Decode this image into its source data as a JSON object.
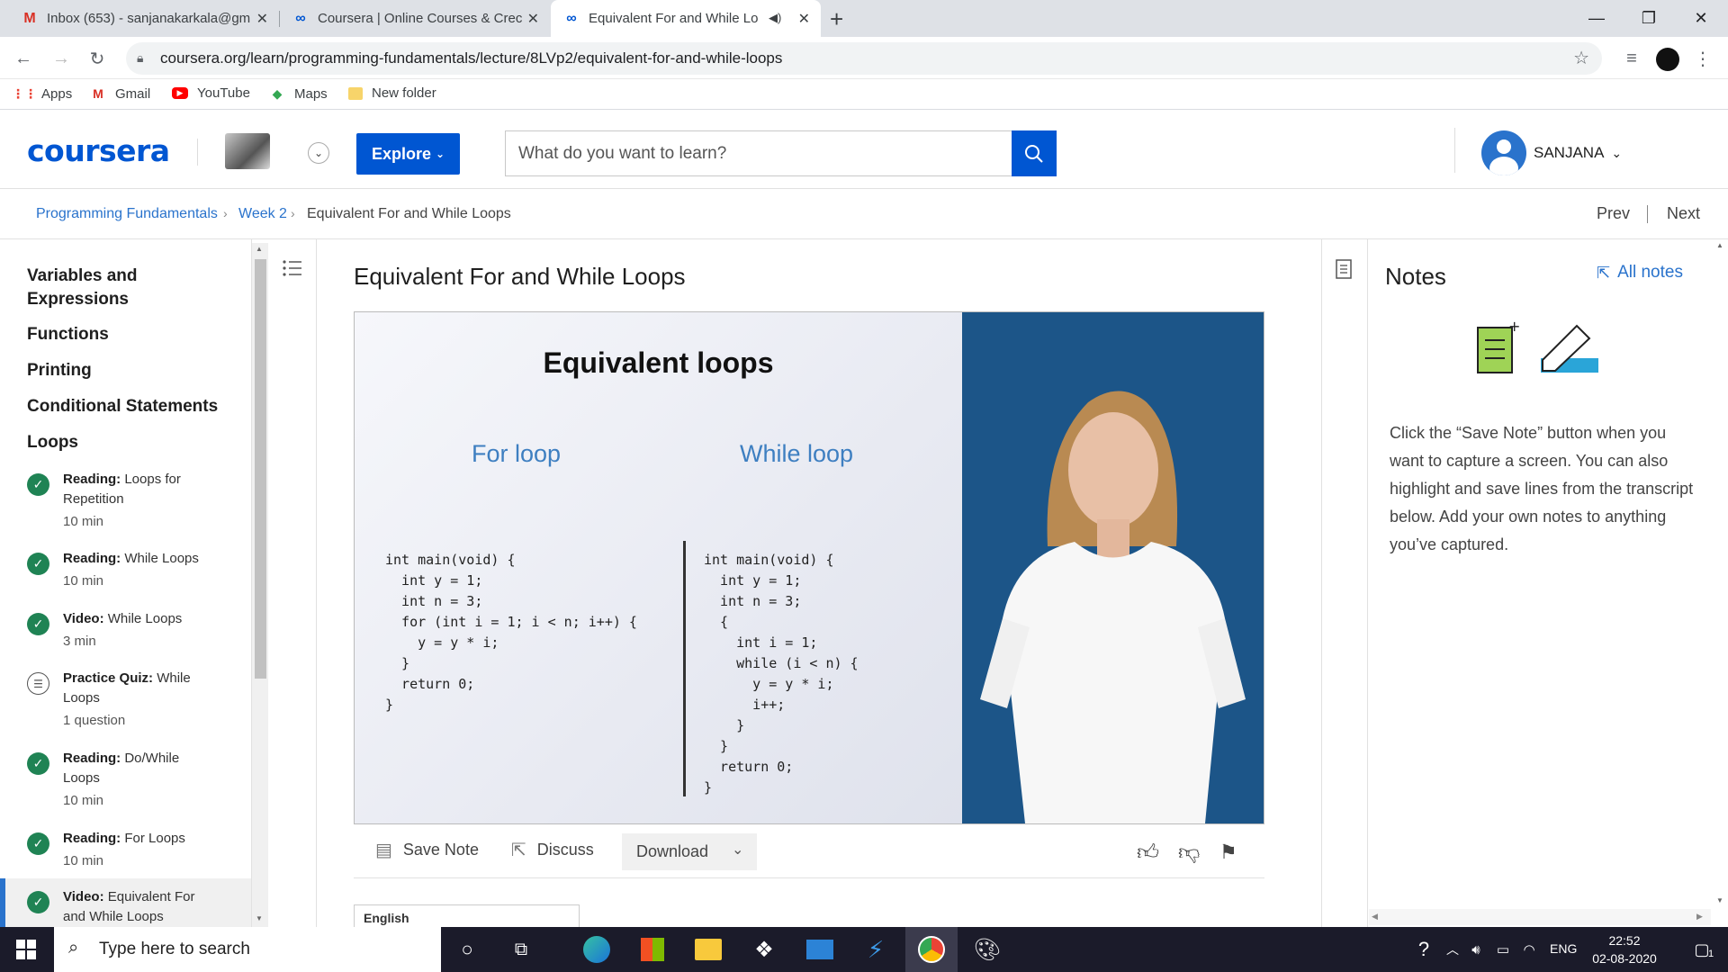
{
  "browser": {
    "tabs": [
      {
        "title": "Inbox (653) - sanjanakarkala@gm",
        "icon": "gmail-icon",
        "active": false
      },
      {
        "title": "Coursera | Online Courses & Crec",
        "icon": "coursera-icon",
        "active": false
      },
      {
        "title": "Equivalent For and While Lo",
        "icon": "coursera-icon",
        "active": true
      }
    ],
    "url": "coursera.org/learn/programming-fundamentals/lecture/8LVp2/equivalent-for-and-while-loops",
    "bookmarks": [
      "Apps",
      "Gmail",
      "YouTube",
      "Maps",
      "New folder"
    ]
  },
  "header": {
    "logo": "coursera",
    "explore_label": "Explore",
    "search_placeholder": "What do you want to learn?",
    "user_name": "SANJANA"
  },
  "breadcrumb": {
    "course": "Programming Fundamentals",
    "week": "Week 2",
    "lecture": "Equivalent For and While Loops",
    "prev": "Prev",
    "next": "Next"
  },
  "sidebar": {
    "modules": [
      "Variables and Expressions",
      "Functions",
      "Printing",
      "Conditional Statements",
      "Loops"
    ],
    "items": [
      {
        "type": "Reading:",
        "title": "Loops for Repetition",
        "meta": "10 min",
        "status": "complete"
      },
      {
        "type": "Reading:",
        "title": "While Loops",
        "meta": "10 min",
        "status": "complete"
      },
      {
        "type": "Video:",
        "title": "While Loops",
        "meta": "3 min",
        "status": "complete"
      },
      {
        "type": "Practice Quiz:",
        "title": "While Loops",
        "meta": "1 question",
        "status": "quiz"
      },
      {
        "type": "Reading:",
        "title": "Do/While Loops",
        "meta": "10 min",
        "status": "complete"
      },
      {
        "type": "Reading:",
        "title": "For Loops",
        "meta": "10 min",
        "status": "complete"
      },
      {
        "type": "Video:",
        "title": "Equivalent For and While Loops",
        "meta": "",
        "status": "complete"
      }
    ]
  },
  "lecture": {
    "title": "Equivalent For and While Loops",
    "slide": {
      "heading": "Equivalent loops",
      "left_label": "For loop",
      "right_label": "While loop",
      "left_code": "int main(void) {\n  int y = 1;\n  int n = 3;\n  for (int i = 1; i < n; i++) {\n    y = y * i;\n  }\n  return 0;\n}",
      "right_code": "int main(void) {\n  int y = 1;\n  int n = 3;\n  {\n    int i = 1;\n    while (i < n) {\n      y = y * i;\n      i++;\n    }\n  }\n  return 0;\n}"
    },
    "tools": {
      "save_note": "Save Note",
      "discuss": "Discuss",
      "download": "Download"
    },
    "language": "English"
  },
  "notes": {
    "title": "Notes",
    "all_notes": "All notes",
    "body": "Click the “Save Note” button when you want to capture a screen. You can also highlight and save lines from the transcript below. Add your own notes to anything you’ve captured."
  },
  "taskbar": {
    "search_placeholder": "Type here to search",
    "lang": "ENG",
    "time": "22:52",
    "date": "02-08-2020",
    "notif_count": "1"
  },
  "colors": {
    "brand": "#0056d2",
    "link": "#2a73cc",
    "complete": "#1f8354",
    "stage": "#1c5588"
  }
}
